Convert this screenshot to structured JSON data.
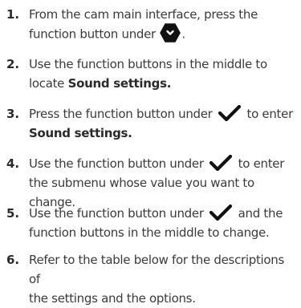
{
  "steps": [
    {
      "number": "1.",
      "line1": "From the cam main interface, press the",
      "line2_before": "function button under",
      "icon": "hexagon-nav-icon",
      "line2_after": "."
    },
    {
      "number": "2.",
      "line1": "Use the function buttons in the middle to",
      "line2_before": "locate",
      "line2_bold": "Sound settings."
    },
    {
      "number": "3.",
      "line1_before": "Press the function button under",
      "icon": "checkmark-icon",
      "line1_after": "to enter",
      "line2_bold": "Sound settings."
    },
    {
      "number": "4.",
      "line1_before": "Use the function button under",
      "icon": "checkmark-icon",
      "line1_after": "to enter",
      "line2": "the submenu whose value you want to change."
    },
    {
      "number": "5.",
      "line1_before": "Use the function button under",
      "icon": "checkmark-icon",
      "line1_after": "and the",
      "line2": "function buttons in the middle to change."
    },
    {
      "number": "6.",
      "line1": "Refer to the table below for the descriptions of",
      "line2": "the settings and the options."
    }
  ],
  "icon_color": "#111111"
}
